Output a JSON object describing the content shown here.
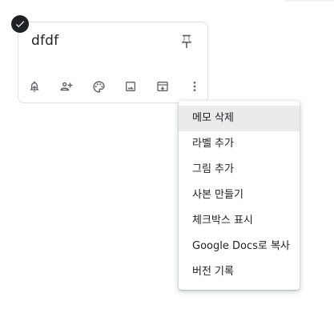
{
  "note": {
    "title": "dfdf",
    "selected": true
  },
  "toolbar": {
    "items": [
      {
        "icon": "add-reminder-icon"
      },
      {
        "icon": "collaborator-icon"
      },
      {
        "icon": "palette-icon"
      },
      {
        "icon": "image-icon"
      },
      {
        "icon": "archive-icon"
      },
      {
        "icon": "more-vert-icon"
      }
    ]
  },
  "menu": {
    "items": [
      {
        "label": "메모 삭제"
      },
      {
        "label": "라벨 추가"
      },
      {
        "label": "그림 추가"
      },
      {
        "label": "사본 만들기"
      },
      {
        "label": "체크박스 표시"
      },
      {
        "label": "Google Docs로 복사"
      },
      {
        "label": "버전 기록"
      }
    ],
    "highlighted_item": "메모 삭제"
  },
  "colors": {
    "text": "#202124",
    "icon": "#5f6368",
    "border": "#e0e0e0",
    "menu_hover": "#ebebeb"
  }
}
